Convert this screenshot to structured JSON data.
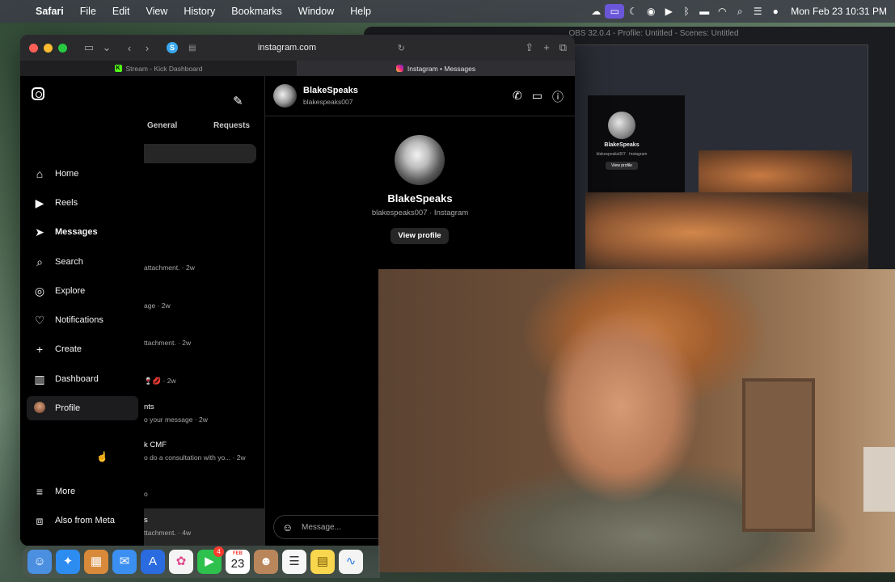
{
  "menubar": {
    "app": "Safari",
    "items": [
      "File",
      "Edit",
      "View",
      "History",
      "Bookmarks",
      "Window",
      "Help"
    ],
    "clock": "Mon Feb 23  10:31 PM"
  },
  "obs": {
    "title": "OBS 32.0.4 - Profile: Untitled - Scenes: Untitled",
    "mirror_name": "BlakeSpeaks",
    "mirror_sub": "blakespeaks007 · Instagram",
    "mirror_button": "View profile"
  },
  "safari": {
    "url": "instagram.com",
    "tabs": [
      {
        "label": "Stream - Kick Dashboard"
      },
      {
        "label": "Instagram • Messages"
      }
    ]
  },
  "ig_nav": {
    "items": [
      {
        "label": "Home",
        "icon": "home-icon"
      },
      {
        "label": "Reels",
        "icon": "reels-icon"
      },
      {
        "label": "Messages",
        "icon": "messages-icon"
      },
      {
        "label": "Search",
        "icon": "search-icon"
      },
      {
        "label": "Explore",
        "icon": "explore-icon"
      },
      {
        "label": "Notifications",
        "icon": "heart-icon"
      },
      {
        "label": "Create",
        "icon": "plus-icon"
      },
      {
        "label": "Dashboard",
        "icon": "dashboard-icon"
      },
      {
        "label": "Profile",
        "icon": "profile-avatar"
      }
    ],
    "more": "More",
    "meta": "Also from Meta"
  },
  "ig_list": {
    "tab_general": "General",
    "tab_requests": "Requests",
    "conversations": [
      {
        "name": "",
        "preview": "attachment. · 2w"
      },
      {
        "name": "",
        "preview": "age · 2w"
      },
      {
        "name": "",
        "preview": "ttachment. · 2w"
      },
      {
        "name": "",
        "preview": "🍷💋 · 2w"
      },
      {
        "name": "nts",
        "preview": "o your message · 2w"
      },
      {
        "name": "k CMF",
        "preview": "o do a consultation with yo... · 2w"
      },
      {
        "name": "",
        "preview": "o"
      },
      {
        "name": "s",
        "preview": "ttachment. · 4w"
      }
    ]
  },
  "ig_chat": {
    "name": "BlakeSpeaks",
    "username": "blakespeaks007",
    "profile_name": "BlakeSpeaks",
    "profile_sub": "blakespeaks007 · Instagram",
    "view_profile": "View profile",
    "message_placeholder": "Message..."
  },
  "dock": {
    "facetime_badge": "4",
    "calendar_month": "FEB",
    "calendar_day": "23"
  }
}
